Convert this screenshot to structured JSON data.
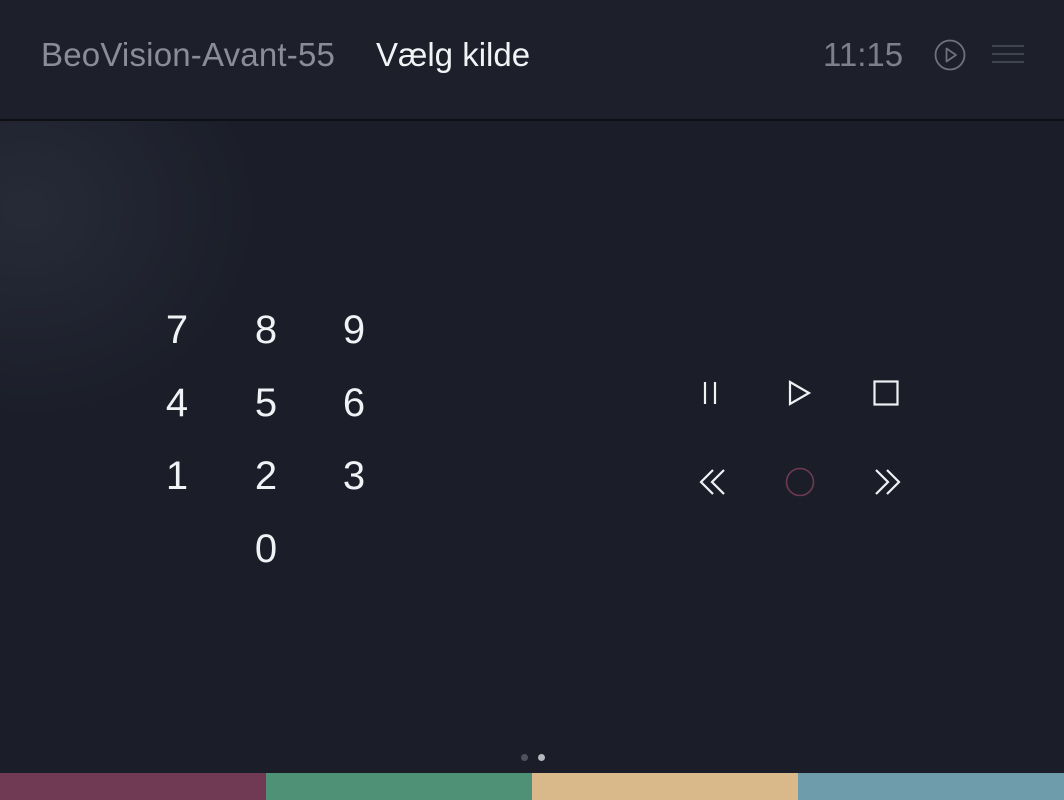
{
  "header": {
    "device_name": "BeoVision-Avant-55",
    "source_title": "Vælg kilde",
    "clock": "11:15",
    "now_playing_icon": "play-circle-icon",
    "menu_icon": "hamburger-menu-icon"
  },
  "keypad": {
    "keys": [
      "7",
      "8",
      "9",
      "4",
      "5",
      "6",
      "1",
      "2",
      "3",
      "0"
    ]
  },
  "transport": {
    "buttons": [
      "pause",
      "play",
      "stop",
      "rewind",
      "record",
      "fast-forward"
    ],
    "record_color": "#6e3a52"
  },
  "pagination": {
    "pages": 2,
    "current": 2
  },
  "color_buttons": [
    {
      "name": "red",
      "color": "#703a55"
    },
    {
      "name": "green",
      "color": "#4e9177"
    },
    {
      "name": "yellow",
      "color": "#d9b98a"
    },
    {
      "name": "blue",
      "color": "#6e9cab"
    }
  ]
}
